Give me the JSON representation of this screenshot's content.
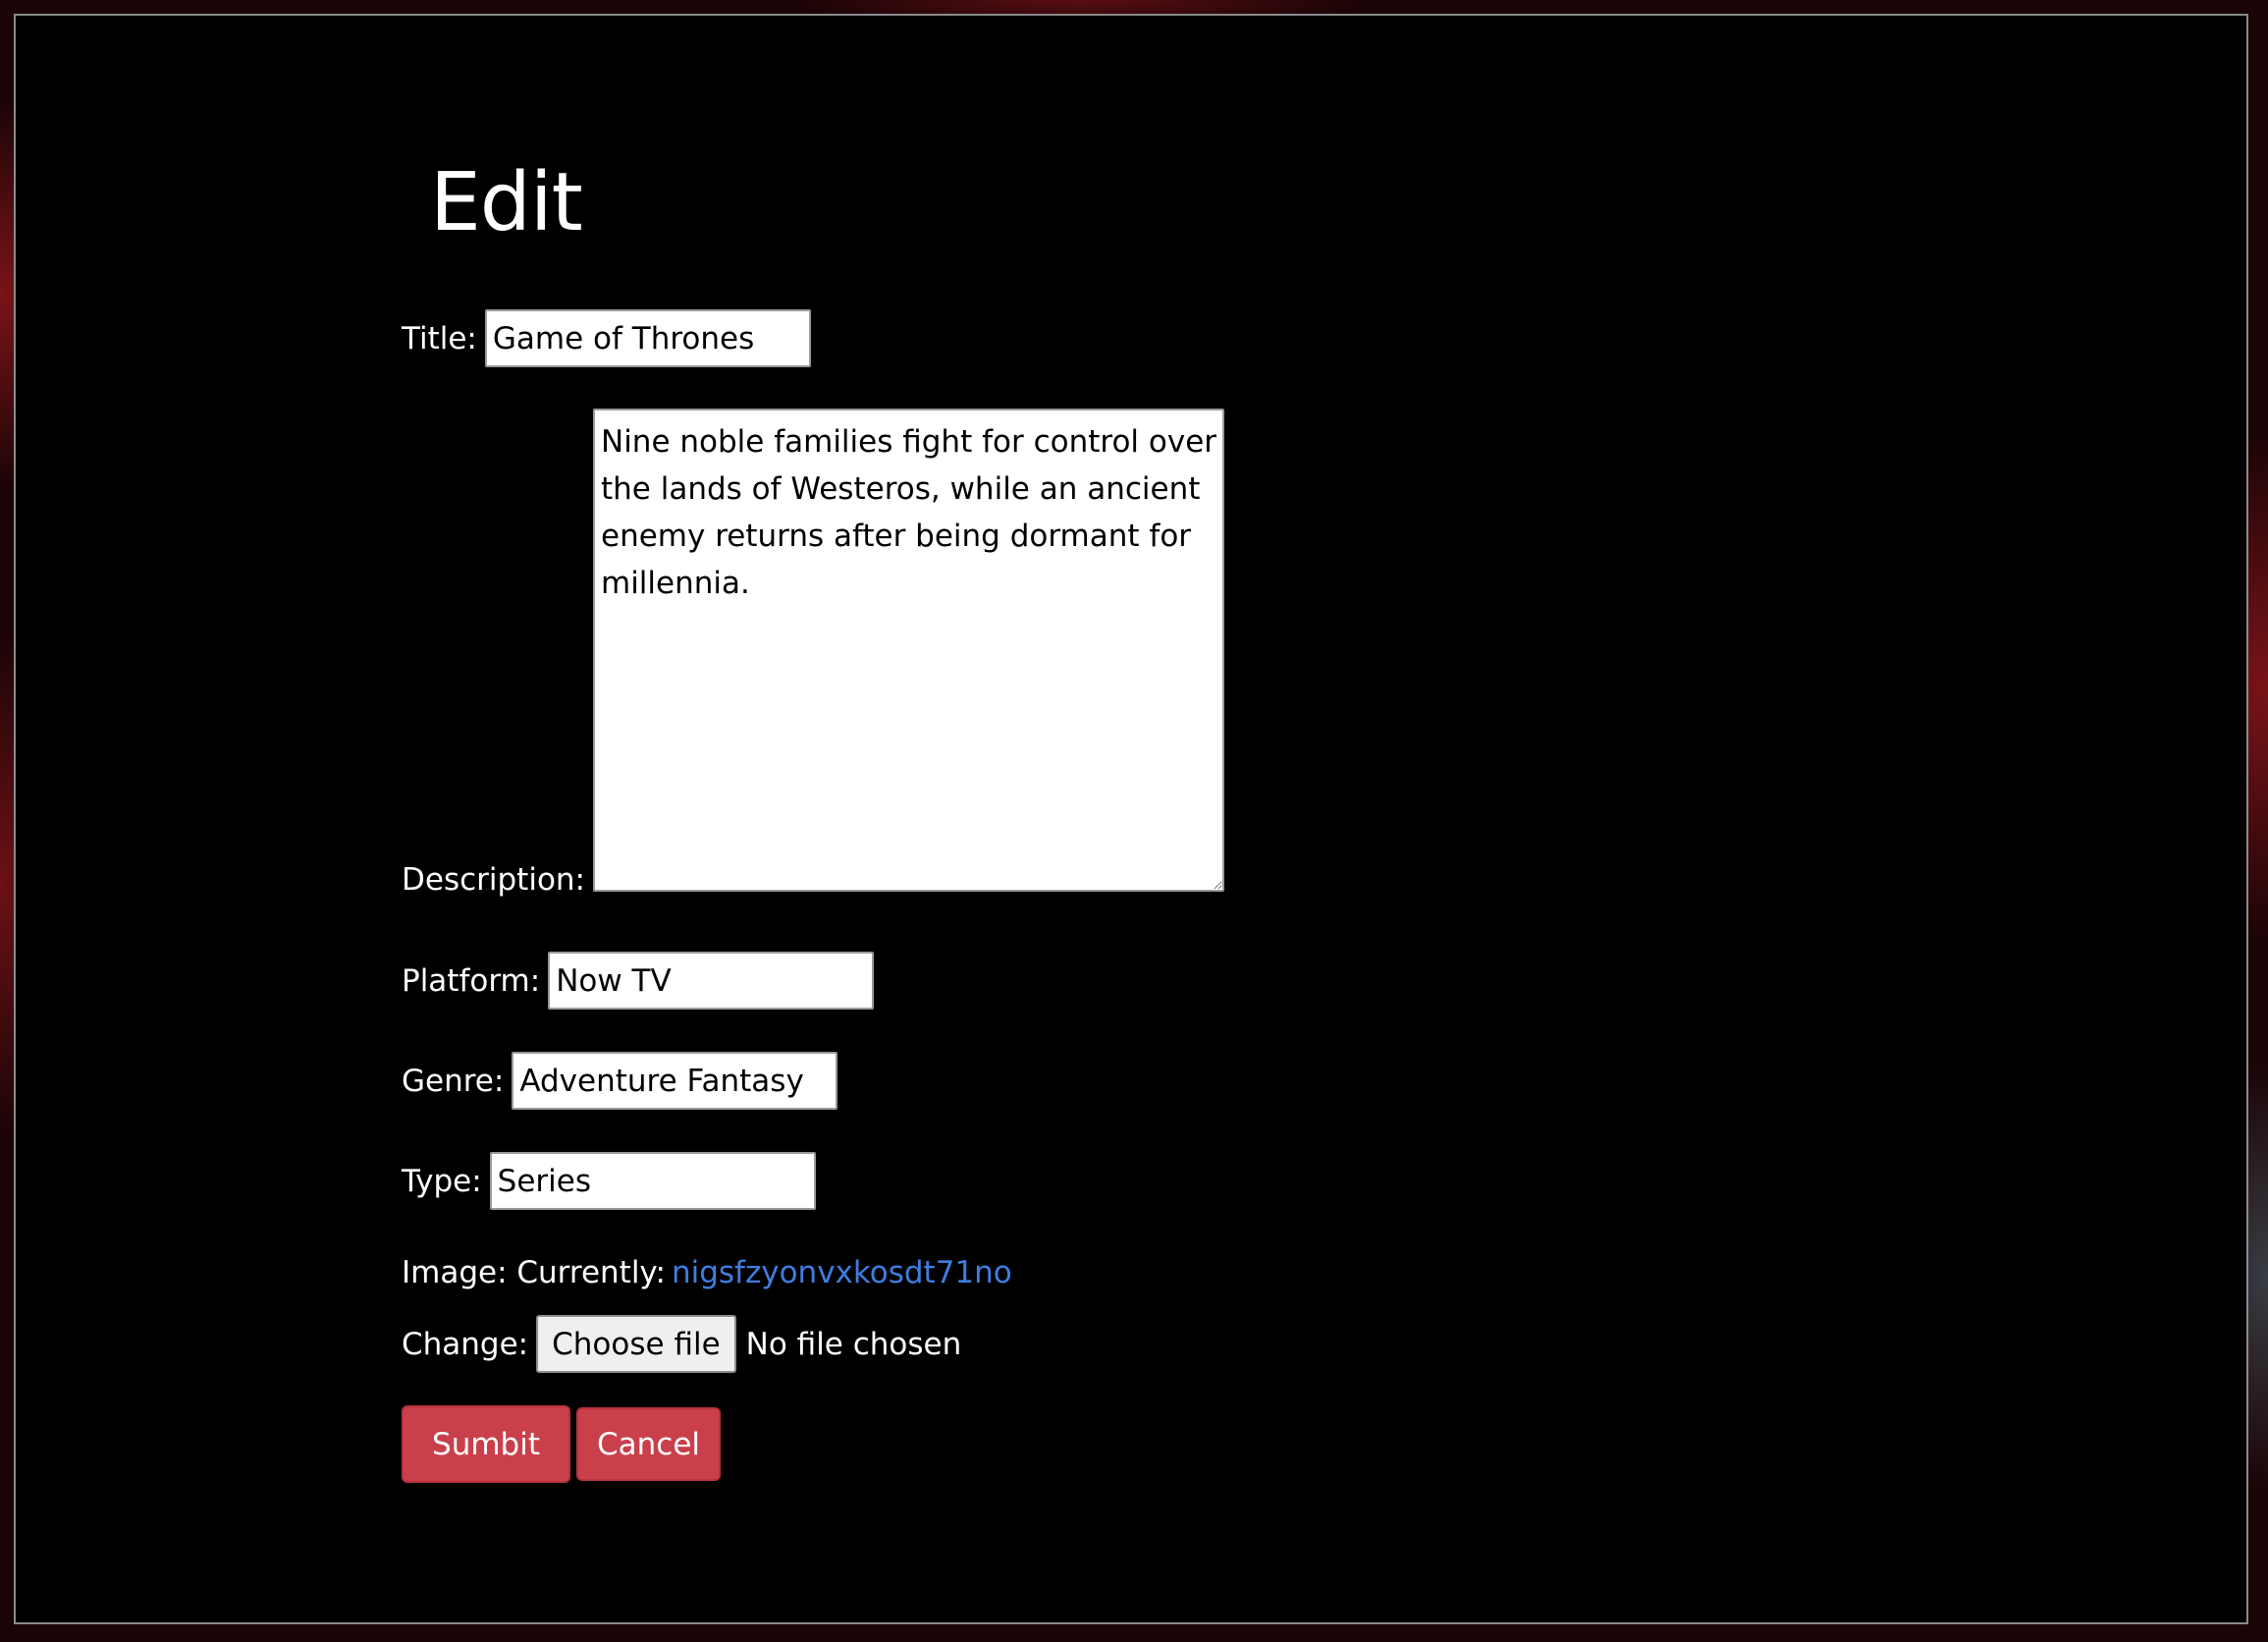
{
  "page": {
    "heading": "Edit"
  },
  "form": {
    "title": {
      "label": "Title:",
      "value": "Game of Thrones"
    },
    "description": {
      "label": "Description:",
      "value": "Nine noble families fight for control over the lands of Westeros, while an ancient enemy returns after being dormant for millennia."
    },
    "platform": {
      "label": "Platform:",
      "value": "Now TV"
    },
    "genre": {
      "label": "Genre:",
      "value": "Adventure Fantasy"
    },
    "type": {
      "label": "Type:",
      "value": "Series"
    },
    "image": {
      "label": "Image: Currently:",
      "current_link": "nigsfzyonvxkosdt71no"
    },
    "change": {
      "label": "Change:",
      "button_label": "Choose file",
      "status": "No file chosen"
    },
    "submit_label": "Sumbit",
    "cancel_label": "Cancel"
  },
  "colors": {
    "panel_background": "#000000",
    "button_accent": "#c9404b",
    "link": "#3f7de0"
  }
}
